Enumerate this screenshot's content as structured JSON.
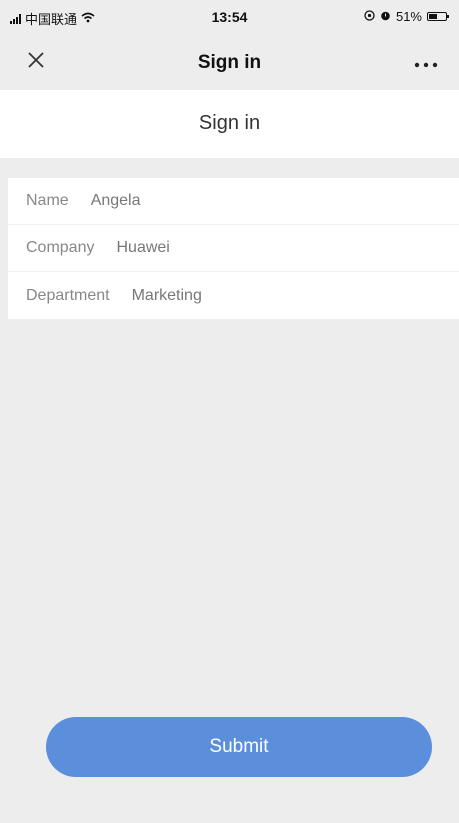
{
  "status_bar": {
    "carrier": "中国联通",
    "time": "13:54",
    "battery": "51%",
    "battery_level": 0.51
  },
  "nav": {
    "title": "Sign in",
    "close_icon": "close-icon",
    "more_icon": "more-icon"
  },
  "page": {
    "title": "Sign in"
  },
  "form": {
    "rows": [
      {
        "label": "Name",
        "value": "Angela"
      },
      {
        "label": "Company",
        "value": "Huawei"
      },
      {
        "label": "Department",
        "value": "Marketing"
      }
    ]
  },
  "submit": {
    "label": "Submit"
  },
  "colors": {
    "background": "#ededed",
    "accent": "#5b8fdc",
    "card": "#ffffff"
  }
}
